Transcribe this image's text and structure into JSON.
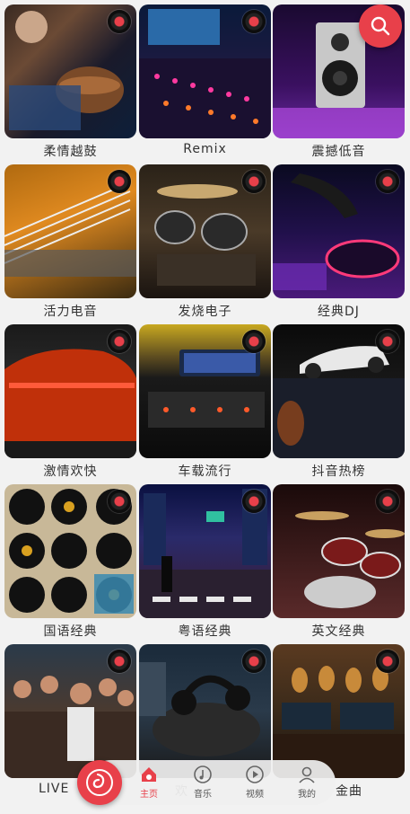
{
  "colors": {
    "accent": "#e8404a",
    "background": "#f2f2f2"
  },
  "tiles": [
    {
      "label": "柔情越鼓",
      "art": "drummer-photo"
    },
    {
      "label": "Remix",
      "art": "mixer-console-photo"
    },
    {
      "label": "震撼低音",
      "art": "speaker-photo"
    },
    {
      "label": "活力电音",
      "art": "guitar-strings-photo"
    },
    {
      "label": "发烧电子",
      "art": "drum-kit-photo"
    },
    {
      "label": "经典DJ",
      "art": "dj-turntable-photo"
    },
    {
      "label": "激情欢快",
      "art": "red-car-photo"
    },
    {
      "label": "车载流行",
      "art": "car-dashboard-photo"
    },
    {
      "label": "抖音热榜",
      "art": "white-racecar-photo"
    },
    {
      "label": "国语经典",
      "art": "vinyl-records-photo"
    },
    {
      "label": "粤语经典",
      "art": "city-street-photo"
    },
    {
      "label": "英文经典",
      "art": "stage-drums-photo"
    },
    {
      "label": "LIVE",
      "art": "concert-crowd-photo"
    },
    {
      "label": "欢",
      "art": "headphones-turntable-photo"
    },
    {
      "label": "金曲",
      "art": "guitar-studio-photo"
    }
  ],
  "search_icon": "search-icon",
  "tabbar": {
    "fab_icon": "music-note-icon",
    "tabs": [
      {
        "label": "主页",
        "icon": "home-icon",
        "active": true
      },
      {
        "label": "音乐",
        "icon": "music-icon",
        "active": false
      },
      {
        "label": "视频",
        "icon": "play-icon",
        "active": false
      },
      {
        "label": "我的",
        "icon": "user-icon",
        "active": false
      }
    ]
  }
}
